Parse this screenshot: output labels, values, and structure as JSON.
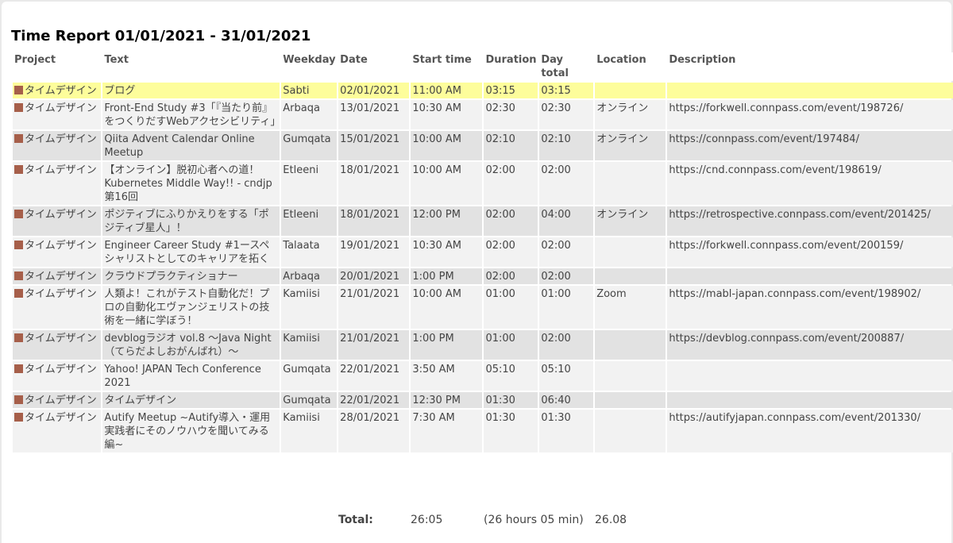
{
  "title": "Time Report 01/01/2021 - 31/01/2021",
  "colors": {
    "project_swatch": "#a65f4a",
    "highlight": "#fdfd9b"
  },
  "columns": {
    "project": "Project",
    "text": "Text",
    "weekday": "Weekday",
    "date": "Date",
    "start": "Start time",
    "duration": "Duration",
    "day_total_1": "Day",
    "day_total_2": "total",
    "location": "Location",
    "description": "Description"
  },
  "rows": [
    {
      "project": "タイムデザイン",
      "text": "ブログ",
      "weekday": "Sabti",
      "date": "02/01/2021",
      "start": "11:00 AM",
      "duration": "03:15",
      "day_total": "03:15",
      "day_total_faded": false,
      "location": "",
      "description": "",
      "highlight": true
    },
    {
      "project": "タイムデザイン",
      "text": "Front-End Study #3「『当たり前』をつくりだすWebアクセシビリティ」",
      "weekday": "Arbaqa",
      "date": "13/01/2021",
      "start": "10:30 AM",
      "duration": "02:30",
      "day_total": "02:30",
      "day_total_faded": false,
      "location": "オンライン",
      "description": "https://forkwell.connpass.com/event/198726/",
      "highlight": false
    },
    {
      "project": "タイムデザイン",
      "text": "Qiita Advent Calendar Online Meetup",
      "weekday": "Gumqata",
      "date": "15/01/2021",
      "start": "10:00 AM",
      "duration": "02:10",
      "day_total": "02:10",
      "day_total_faded": false,
      "location": "オンライン",
      "description": "https://connpass.com/event/197484/",
      "highlight": false
    },
    {
      "project": "タイムデザイン",
      "text": "【オンライン】脱初心者への道！Kubernetes Middle Way!! - cndjp第16回",
      "weekday": "Etleeni",
      "date": "18/01/2021",
      "start": "10:00 AM",
      "duration": "02:00",
      "day_total": "02:00",
      "day_total_faded": true,
      "location": "",
      "description": "https://cnd.connpass.com/event/198619/",
      "highlight": false
    },
    {
      "project": "タイムデザイン",
      "text": "ポジティブにふりかえりをする「ポジティブ星人」！",
      "weekday": "Etleeni",
      "date": "18/01/2021",
      "start": "12:00 PM",
      "duration": "02:00",
      "day_total": "04:00",
      "day_total_faded": false,
      "location": "オンライン",
      "description": "https://retrospective.connpass.com/event/201425/",
      "highlight": false
    },
    {
      "project": "タイムデザイン",
      "text": "Engineer Career Study #1ースペシャリストとしてのキャリアを拓く",
      "weekday": "Talaata",
      "date": "19/01/2021",
      "start": "10:30 AM",
      "duration": "02:00",
      "day_total": "02:00",
      "day_total_faded": false,
      "location": "",
      "description": "https://forkwell.connpass.com/event/200159/",
      "highlight": false
    },
    {
      "project": "タイムデザイン",
      "text": "クラウドプラクティショナー",
      "weekday": "Arbaqa",
      "date": "20/01/2021",
      "start": "1:00 PM",
      "duration": "02:00",
      "day_total": "02:00",
      "day_total_faded": false,
      "location": "",
      "description": "",
      "highlight": false
    },
    {
      "project": "タイムデザイン",
      "text": "人類よ！これがテスト自動化だ！プロの自動化エヴァンジェリストの技術を一緒に学ぼう！",
      "weekday": "Kamiisi",
      "date": "21/01/2021",
      "start": "10:00 AM",
      "duration": "01:00",
      "day_total": "01:00",
      "day_total_faded": true,
      "location": "Zoom",
      "description": "https://mabl-japan.connpass.com/event/198902/",
      "highlight": false
    },
    {
      "project": "タイムデザイン",
      "text": "devblogラジオ vol.8 ～Java Night（てらだよしおがんばれ）～",
      "weekday": "Kamiisi",
      "date": "21/01/2021",
      "start": "1:00 PM",
      "duration": "01:00",
      "day_total": "02:00",
      "day_total_faded": false,
      "location": "",
      "description": "https://devblog.connpass.com/event/200887/",
      "highlight": false
    },
    {
      "project": "タイムデザイン",
      "text": "Yahoo! JAPAN Tech Conference 2021",
      "weekday": "Gumqata",
      "date": "22/01/2021",
      "start": "3:50 AM",
      "duration": "05:10",
      "day_total": "05:10",
      "day_total_faded": true,
      "location": "",
      "description": "",
      "highlight": false
    },
    {
      "project": "タイムデザイン",
      "text": "タイムデザイン",
      "weekday": "Gumqata",
      "date": "22/01/2021",
      "start": "12:30 PM",
      "duration": "01:30",
      "day_total": "06:40",
      "day_total_faded": false,
      "location": "",
      "description": "",
      "highlight": false
    },
    {
      "project": "タイムデザイン",
      "text": "Autify Meetup ~Autify導入・運用実践者にそのノウハウを聞いてみる編~",
      "weekday": "Kamiisi",
      "date": "28/01/2021",
      "start": "7:30 AM",
      "duration": "01:30",
      "day_total": "01:30",
      "day_total_faded": false,
      "location": "",
      "description": "https://autifyjapan.connpass.com/event/201330/",
      "highlight": false
    }
  ],
  "totals": {
    "label": "Total:",
    "time": "26:05",
    "hours_text": "(26 hours 05 min)",
    "decimal": "26.08"
  }
}
